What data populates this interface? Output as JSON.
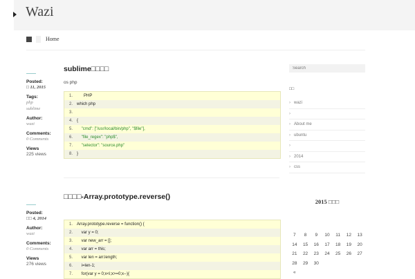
{
  "site": {
    "title": "Wazi"
  },
  "nav": {
    "home": "Home"
  },
  "posts": [
    {
      "title": "sublime□□□□",
      "tags_line": "os php",
      "meta": {
        "posted_label": "Posted:",
        "posted_value": "□ 11, 2015",
        "tags_label": "Tags:",
        "tags": [
          "php",
          "sublime"
        ],
        "author_label": "Author:",
        "author": "wazi",
        "comments_label": "Comments:",
        "comments": "0 Comments",
        "views_label": "Views",
        "views": "225 views"
      },
      "code": [
        {
          "n": "1.",
          "t": "      PHP"
        },
        {
          "n": "2.",
          "t": "which php"
        },
        {
          "n": "3.",
          "t": ""
        },
        {
          "n": "4.",
          "t": "{"
        },
        {
          "n": "5.",
          "t": "    \"cmd\": [\"/usr/local/bin/php\", \"$file\"],",
          "str": true
        },
        {
          "n": "6.",
          "t": "    \"file_regex\": \"php$\",",
          "str": true
        },
        {
          "n": "7.",
          "t": "    \"selector\": \"source.php\"",
          "str": true
        },
        {
          "n": "8.",
          "t": "}"
        }
      ]
    },
    {
      "title": "□□□□-Array.prototype.reverse()",
      "meta": {
        "posted_label": "Posted:",
        "posted_value": "□□ 4, 2014",
        "author_label": "Author:",
        "author": "wazi",
        "comments_label": "Comments:",
        "comments": "0 Comments",
        "views_label": "Views",
        "views": "276 views"
      },
      "code": [
        {
          "n": "1.",
          "t": "Array.prototype.reverse = function() {"
        },
        {
          "n": "2.",
          "t": "    var y = 0;"
        },
        {
          "n": "3.",
          "t": "    var new_arr = [];"
        },
        {
          "n": "4.",
          "t": "    var arr = this;"
        },
        {
          "n": "5.",
          "t": "    var len = arr.length;"
        },
        {
          "n": "6.",
          "t": "    i=len-1;"
        },
        {
          "n": "7.",
          "t": "    for(var y = 0;x<i;x>=0;x--){"
        }
      ]
    }
  ],
  "sidebar": {
    "search_placeholder": "Search",
    "heading": "□□",
    "links": [
      "wazi",
      "",
      "About me",
      "ubuntu",
      "",
      "2014",
      "css"
    ],
    "calendar_title": "2015 □□□",
    "calendar_rows": [
      [
        "",
        "",
        "",
        "",
        "",
        "",
        ""
      ],
      [
        "",
        "",
        "",
        "",
        "",
        "",
        ""
      ],
      [
        "7",
        "8",
        "9",
        "10",
        "11",
        "12",
        "13"
      ],
      [
        "14",
        "15",
        "16",
        "17",
        "18",
        "19",
        "20"
      ],
      [
        "21",
        "22",
        "23",
        "24",
        "25",
        "26",
        "27"
      ],
      [
        "28",
        "29",
        "30",
        "",
        "",
        "",
        ""
      ],
      [
        "«",
        "",
        "",
        "",
        "",
        "",
        ""
      ]
    ]
  }
}
